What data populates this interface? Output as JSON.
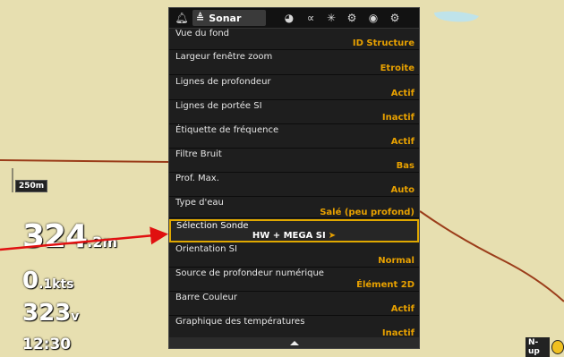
{
  "map": {
    "scale": "250m",
    "depth": {
      "value": "324",
      "unit": ".2m"
    },
    "speed": {
      "value": "0",
      "unit": ".1kts"
    },
    "voltage": {
      "value": "323",
      "unit": "v"
    },
    "time": "12:30",
    "orientation": "N-up"
  },
  "menu": {
    "title": "Sonar",
    "tab_icons": [
      "bell-icon",
      "sonar-icon",
      "navigation-icon",
      "fish-icon",
      "chart-icon",
      "gear-icon",
      "eye-icon",
      "accessories-icon"
    ],
    "items": [
      {
        "label": "Vue du fond",
        "value": "ID Structure"
      },
      {
        "label": "Largeur fenêtre zoom",
        "value": "Etroite"
      },
      {
        "label": "Lignes de profondeur",
        "value": "Actif"
      },
      {
        "label": "Lignes de portée SI",
        "value": "Inactif"
      },
      {
        "label": "Étiquette de fréquence",
        "value": "Actif"
      },
      {
        "label": "Filtre Bruit",
        "value": "Bas"
      },
      {
        "label": "Prof. Max.",
        "value": "Auto"
      },
      {
        "label": "Type d'eau",
        "value": "Salé (peu profond)"
      },
      {
        "label": "Sélection Sonde",
        "value": "HW + MEGA SI",
        "selected": true,
        "submenu_arrow": "➤"
      },
      {
        "label": "Orientation SI",
        "value": "Normal"
      },
      {
        "label": "Source de profondeur numérique",
        "value": "Élément 2D"
      },
      {
        "label": "Barre Couleur",
        "value": "Actif"
      },
      {
        "label": "Graphique des températures",
        "value": "Inactif"
      }
    ]
  },
  "colors": {
    "map_land": "#e7dfb0",
    "contour": "#9b3d1a",
    "value_accent": "#e8a100",
    "callout_arrow": "#e01010"
  }
}
